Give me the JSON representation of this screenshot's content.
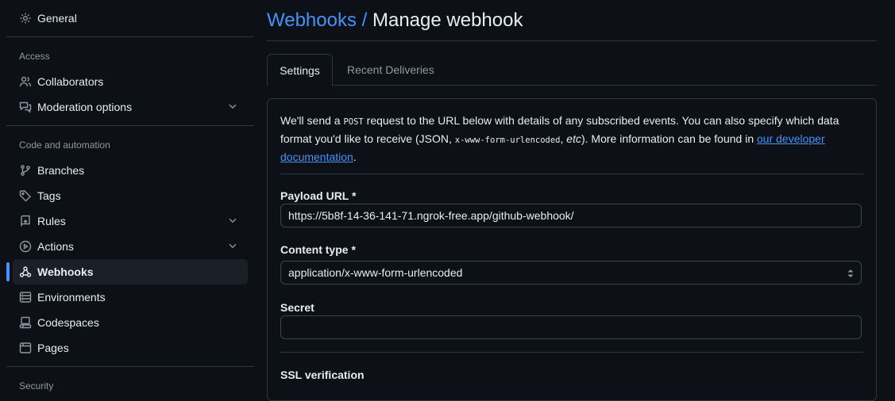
{
  "sidebar": {
    "general": "General",
    "access_title": "Access",
    "collaborators": "Collaborators",
    "moderation": "Moderation options",
    "code_title": "Code and automation",
    "branches": "Branches",
    "tags": "Tags",
    "rules": "Rules",
    "actions": "Actions",
    "webhooks": "Webhooks",
    "environments": "Environments",
    "codespaces": "Codespaces",
    "pages": "Pages",
    "security_title": "Security"
  },
  "header": {
    "crumb": "Webhooks",
    "separator": " / ",
    "title": "Manage webhook"
  },
  "tabs": {
    "settings": "Settings",
    "recent": "Recent Deliveries"
  },
  "intro": {
    "p1": "We'll send a ",
    "post": "POST",
    "p2": " request to the URL below with details of any subscribed events. You can also specify which data format you'd like to receive (JSON, ",
    "form": "x-www-form-urlencoded",
    "p3": ", ",
    "etc": "etc",
    "p4": "). More information can be found in ",
    "link": "our developer documentation",
    "p5": "."
  },
  "form": {
    "payload_label": "Payload URL *",
    "payload_value": "https://5b8f-14-36-141-71.ngrok-free.app/github-webhook/",
    "content_label": "Content type *",
    "content_value": "application/x-www-form-urlencoded",
    "secret_label": "Secret",
    "secret_value": "",
    "ssl_label": "SSL verification"
  },
  "colors": {
    "accent": "#4493f8",
    "bg": "#0d1117",
    "border": "#30363d"
  }
}
